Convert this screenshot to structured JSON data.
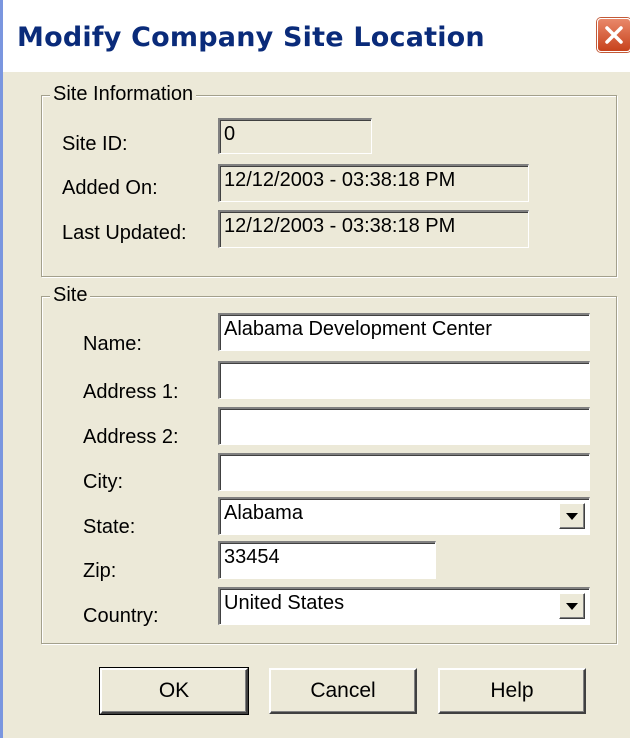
{
  "window": {
    "title": "Modify Company Site Location",
    "close_icon": "close-icon"
  },
  "site_information": {
    "legend": "Site Information",
    "site_id_label": "Site ID:",
    "site_id_value": "0",
    "added_on_label": "Added On:",
    "added_on_value": "12/12/2003 - 03:38:18 PM",
    "last_updated_label": "Last Updated:",
    "last_updated_value": "12/12/2003 - 03:38:18 PM"
  },
  "site": {
    "legend": "Site",
    "name_label": "Name:",
    "name_value": "Alabama Development Center",
    "address1_label": "Address 1:",
    "address1_value": "",
    "address2_label": "Address 2:",
    "address2_value": "",
    "city_label": "City:",
    "city_value": "",
    "state_label": "State:",
    "state_value": "Alabama",
    "zip_label": "Zip:",
    "zip_value": "33454",
    "country_label": "Country:",
    "country_value": "United States"
  },
  "buttons": {
    "ok": "OK",
    "cancel": "Cancel",
    "help": "Help"
  },
  "colors": {
    "dialog_bg": "#ece9d8",
    "title_text": "#0a2b7a",
    "close_button": "#c7421c"
  }
}
